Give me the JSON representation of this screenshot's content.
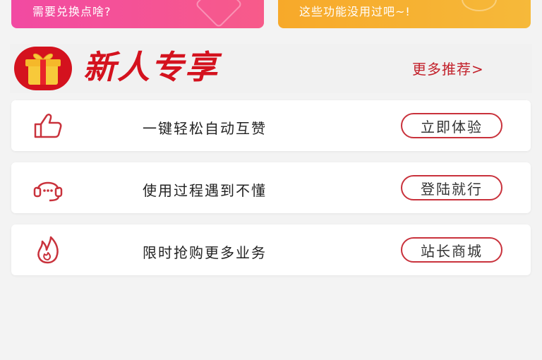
{
  "top_cards": {
    "left_text": "需要兑换点啥?",
    "right_text": "这些功能没用过吧~!"
  },
  "section": {
    "title": "新人专享",
    "more_link": "更多推荐>"
  },
  "features": [
    {
      "icon": "thumbs-up-icon",
      "label": "一键轻松自动互赞",
      "button": "立即体验"
    },
    {
      "icon": "headset-icon",
      "label": "使用过程遇到不懂",
      "button": "登陆就行"
    },
    {
      "icon": "flame-icon",
      "label": "限时抢购更多业务",
      "button": "站长商城"
    }
  ],
  "colors": {
    "accent": "#d4121e",
    "button_border": "#c9323c",
    "left_card": "#f24aa2",
    "right_card": "#f7a92a",
    "background": "#f3f3f3"
  }
}
